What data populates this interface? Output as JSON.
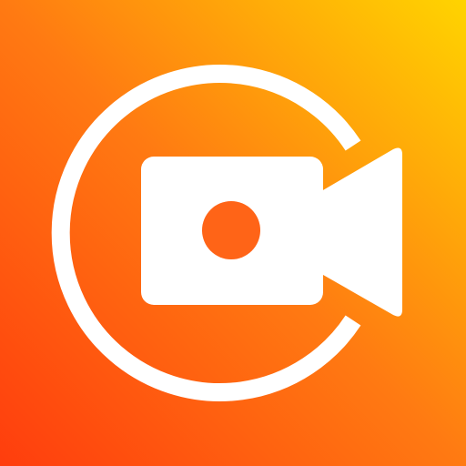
{
  "app_icon": {
    "icon": "screen-recorder-icon",
    "colors": {
      "gradient_start": "#FF3D0D",
      "gradient_mid": "#FF7A12",
      "gradient_end": "#FFD400",
      "glyph": "#FFFFFF"
    }
  }
}
